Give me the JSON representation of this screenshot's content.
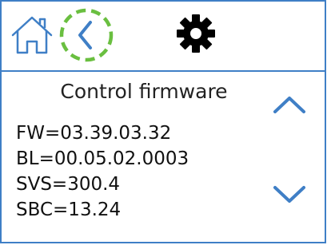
{
  "toolbar": {
    "home_icon": "home-icon",
    "back_icon": "chevron-left-icon",
    "settings_icon": "gear-icon",
    "accent_color": "#3f7fc6",
    "highlight_color": "#6abf40"
  },
  "panel": {
    "title": "Control firmware",
    "lines": [
      "FW=03.39.03.32",
      "BL=00.05.02.0003",
      "SVS=300.4",
      "SBC=13.24"
    ],
    "scroll_up_icon": "chevron-up-icon",
    "scroll_down_icon": "chevron-down-icon"
  }
}
